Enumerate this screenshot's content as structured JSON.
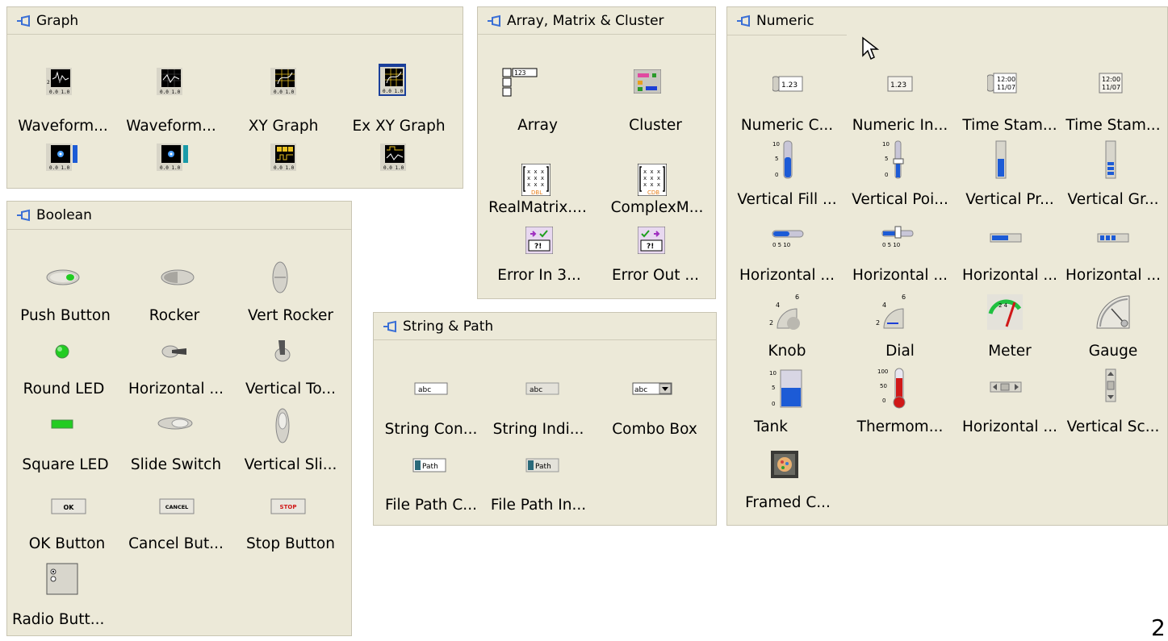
{
  "palettes": {
    "graph": {
      "title": "Graph",
      "items": [
        {
          "label": "Waveform...",
          "icon": "waveform-chart-icon"
        },
        {
          "label": "Waveform...",
          "icon": "waveform-graph-icon"
        },
        {
          "label": "XY Graph",
          "icon": "xy-graph-icon"
        },
        {
          "label": "Ex XY Graph",
          "icon": "express-xy-graph-icon"
        },
        {
          "label": "",
          "icon": "intensity-chart-icon"
        },
        {
          "label": "",
          "icon": "intensity-graph-icon"
        },
        {
          "label": "",
          "icon": "digital-waveform-icon"
        },
        {
          "label": "",
          "icon": "mixed-signal-graph-icon"
        }
      ]
    },
    "array": {
      "title": "Array, Matrix & Cluster",
      "items": [
        {
          "label": "Array",
          "icon": "array-icon"
        },
        {
          "label": "Cluster",
          "icon": "cluster-icon"
        },
        {
          "label": "RealMatrix....",
          "icon": "real-matrix-icon"
        },
        {
          "label": "ComplexM...",
          "icon": "complex-matrix-icon"
        },
        {
          "label": "Error In 3...",
          "icon": "error-in-icon"
        },
        {
          "label": "Error Out ...",
          "icon": "error-out-icon"
        }
      ]
    },
    "numeric": {
      "title": "Numeric",
      "items": [
        {
          "label": "Numeric C...",
          "icon": "numeric-control-icon"
        },
        {
          "label": "Numeric In...",
          "icon": "numeric-indicator-icon"
        },
        {
          "label": "Time Stam...",
          "icon": "time-stamp-control-icon"
        },
        {
          "label": "Time Stam...",
          "icon": "time-stamp-indicator-icon"
        },
        {
          "label": "Vertical Fill ...",
          "icon": "vertical-fill-slide-icon"
        },
        {
          "label": "Vertical Poi...",
          "icon": "vertical-pointer-slide-icon"
        },
        {
          "label": "Vertical Pr...",
          "icon": "vertical-progress-bar-icon"
        },
        {
          "label": "Vertical Gr...",
          "icon": "vertical-graduated-bar-icon"
        },
        {
          "label": "Horizontal ...",
          "icon": "horizontal-fill-slide-icon"
        },
        {
          "label": "Horizontal ...",
          "icon": "horizontal-pointer-slide-icon"
        },
        {
          "label": "Horizontal ...",
          "icon": "horizontal-progress-bar-icon"
        },
        {
          "label": "Horizontal ...",
          "icon": "horizontal-graduated-bar-icon"
        },
        {
          "label": "Knob",
          "icon": "knob-icon"
        },
        {
          "label": "Dial",
          "icon": "dial-icon"
        },
        {
          "label": "Meter",
          "icon": "meter-icon"
        },
        {
          "label": "Gauge",
          "icon": "gauge-icon"
        },
        {
          "label": "Tank",
          "icon": "tank-icon"
        },
        {
          "label": "Thermom...",
          "icon": "thermometer-icon"
        },
        {
          "label": "Horizontal ...",
          "icon": "horizontal-scrollbar-icon"
        },
        {
          "label": "Vertical Sc...",
          "icon": "vertical-scrollbar-icon"
        },
        {
          "label": "Framed C...",
          "icon": "framed-color-box-icon"
        }
      ]
    },
    "boolean": {
      "title": "Boolean",
      "items": [
        {
          "label": "Push Button",
          "icon": "push-button-icon"
        },
        {
          "label": "Rocker",
          "icon": "rocker-icon"
        },
        {
          "label": "Vert Rocker",
          "icon": "vert-rocker-icon"
        },
        {
          "label": "Round LED",
          "icon": "round-led-icon"
        },
        {
          "label": "Horizontal ...",
          "icon": "horizontal-toggle-icon"
        },
        {
          "label": "Vertical To...",
          "icon": "vertical-toggle-icon"
        },
        {
          "label": "Square LED",
          "icon": "square-led-icon"
        },
        {
          "label": "Slide Switch",
          "icon": "slide-switch-icon"
        },
        {
          "label": "Vertical Sli...",
          "icon": "vertical-slide-switch-icon"
        },
        {
          "label": "OK Button",
          "icon": "ok-button-icon",
          "text": "OK"
        },
        {
          "label": "Cancel But...",
          "icon": "cancel-button-icon",
          "text": "CANCEL"
        },
        {
          "label": "Stop Button",
          "icon": "stop-button-icon",
          "text": "STOP"
        },
        {
          "label": "Radio Butt...",
          "icon": "radio-buttons-icon"
        }
      ]
    },
    "string": {
      "title": "String & Path",
      "items": [
        {
          "label": "String Con...",
          "icon": "string-control-icon",
          "text": "abc"
        },
        {
          "label": "String Indi...",
          "icon": "string-indicator-icon",
          "text": "abc"
        },
        {
          "label": "Combo Box",
          "icon": "combo-box-icon",
          "text": "abc"
        },
        {
          "label": "File Path C...",
          "icon": "file-path-control-icon",
          "text": "Path"
        },
        {
          "label": "File Path In...",
          "icon": "file-path-indicator-icon",
          "text": "Path"
        }
      ]
    }
  },
  "icon_text": {
    "numeric": "1.23",
    "timestamp_time": "12:00",
    "timestamp_date": "11/07",
    "array_index": "123",
    "matrix_cells": "x x x",
    "dbl": "DBL",
    "cdb": "CDB",
    "error": "?!",
    "scale_10": "10",
    "scale_5": "5",
    "scale_0": "0",
    "scale_100": "100",
    "scale_50": "50",
    "hscale": "0  5  10",
    "knob_6": "6",
    "knob_4": "4",
    "knob_2": "2",
    "graph_y": "2 1 0",
    "graph_x": "0.0  1.0"
  },
  "page_number": "2",
  "colors": {
    "panel_bg": "#ece9d8",
    "pin_blue": "#3a6fd6",
    "led_green": "#22cc22",
    "fill_blue": "#1c5bd6",
    "thermo_red": "#d01818"
  }
}
